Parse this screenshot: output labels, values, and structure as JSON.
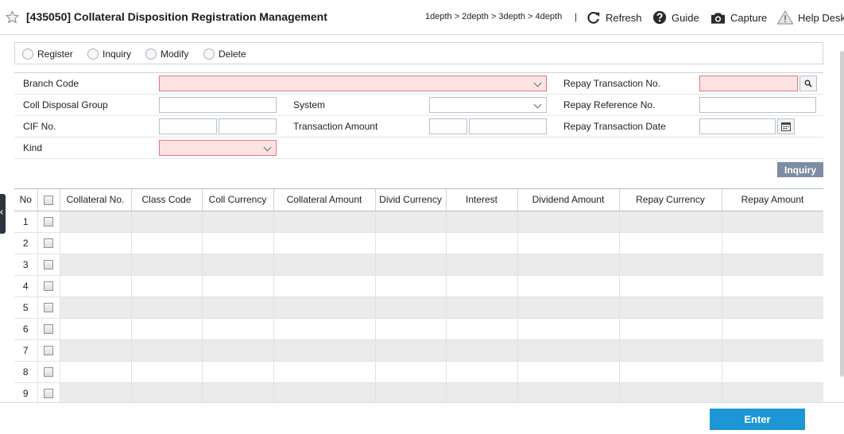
{
  "header": {
    "title": "[435050] Collateral Disposition Registration Management",
    "breadcrumb": "1depth > 2depth > 3depth > 4depth",
    "separator": "|",
    "refresh_label": "Refresh",
    "guide_label": "Guide",
    "capture_label": "Capture",
    "helpdesk_label": "Help Desk"
  },
  "modes": [
    "Register",
    "Inquiry",
    "Modify",
    "Delete"
  ],
  "form": {
    "branch_code_label": "Branch Code",
    "repay_txn_no_label": "Repay Transaction No.",
    "coll_disposal_group_label": "Coll Disposal Group",
    "system_label": "System",
    "repay_ref_no_label": "Repay Reference No.",
    "cif_no_label": "CIF No.",
    "txn_amount_label": "Transaction Amount",
    "repay_txn_date_label": "Repay Transaction Date",
    "kind_label": "Kind",
    "branch_code_value": "",
    "repay_txn_no_value": "",
    "coll_disposal_group_value": "",
    "system_value": "",
    "repay_ref_no_value": "",
    "cif_no_value_1": "",
    "cif_no_value_2": "",
    "txn_amount_value_1": "",
    "txn_amount_value_2": "",
    "repay_txn_date_value": "",
    "kind_value": ""
  },
  "inquiry_button": "Inquiry",
  "table": {
    "columns": [
      "No",
      "",
      "Collateral No.",
      "Class Code",
      "Coll Currency",
      "Collateral Amount",
      "Divid Currency",
      "Interest",
      "Dividend Amount",
      "Repay Currency",
      "Repay Amount"
    ],
    "row_numbers": [
      "1",
      "2",
      "3",
      "4",
      "5",
      "6",
      "7",
      "8",
      "9"
    ]
  },
  "footer": {
    "enter_label": "Enter"
  },
  "colors": {
    "required_bg": "#fde3e3",
    "required_border": "#e7757a",
    "enter_button": "#1d96d5",
    "inquiry_button": "#7d8da3"
  }
}
